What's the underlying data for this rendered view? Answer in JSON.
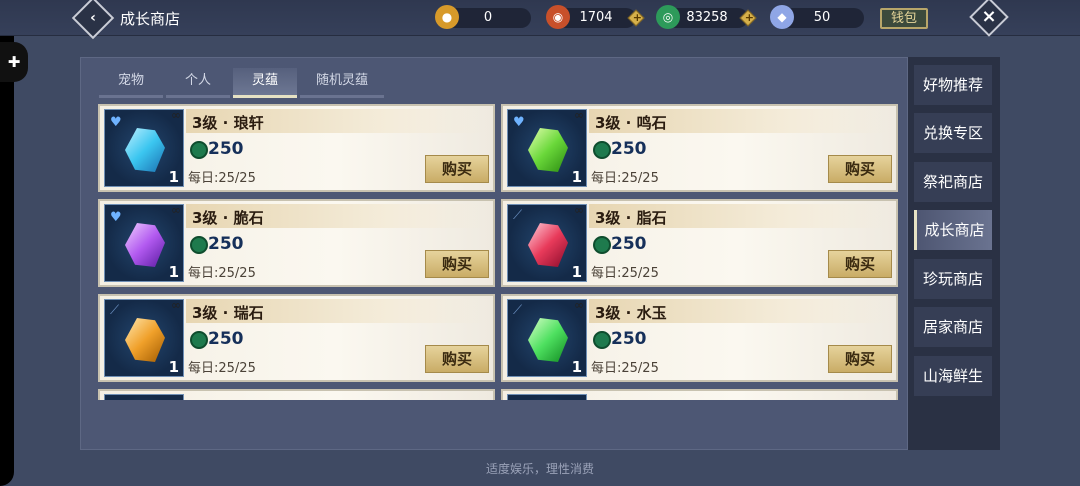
{
  "header": {
    "title": "成长商店",
    "wallet_label": "钱包",
    "currencies": [
      {
        "name": "coin-icon",
        "value": "0",
        "color": "#d79a2a"
      },
      {
        "name": "medal-icon",
        "value": "1704",
        "color": "#c8502a"
      },
      {
        "name": "jade-coin-icon",
        "value": "83258",
        "color": "#2d9a5a"
      },
      {
        "name": "crystal-icon",
        "value": "50",
        "color": "#8fa6e6"
      }
    ]
  },
  "tabs": [
    "宠物",
    "个人",
    "灵蕴",
    "随机灵蕴"
  ],
  "active_tab": "灵蕴",
  "items": [
    {
      "name": "3级 · 琅轩",
      "price": "250",
      "daily": "每日:25/25",
      "qty": "1",
      "buy": "购买",
      "gem_color": "#3bc6f0",
      "badge": "heart"
    },
    {
      "name": "3级 · 鸣石",
      "price": "250",
      "daily": "每日:25/25",
      "qty": "1",
      "buy": "购买",
      "gem_color": "#6ad83a",
      "badge": "heart"
    },
    {
      "name": "3级 · 脆石",
      "price": "250",
      "daily": "每日:25/25",
      "qty": "1",
      "buy": "购买",
      "gem_color": "#b25af0",
      "badge": "heart"
    },
    {
      "name": "3级 · 脂石",
      "price": "250",
      "daily": "每日:25/25",
      "qty": "1",
      "buy": "购买",
      "gem_color": "#e83a5a",
      "badge": "sword"
    },
    {
      "name": "3级 · 瑞石",
      "price": "250",
      "daily": "每日:25/25",
      "qty": "1",
      "buy": "购买",
      "gem_color": "#f0a02a",
      "badge": "sword"
    },
    {
      "name": "3级 · 水玉",
      "price": "250",
      "daily": "每日:25/25",
      "qty": "1",
      "buy": "购买",
      "gem_color": "#4ee060",
      "badge": "sword"
    }
  ],
  "nav": [
    "好物推荐",
    "兑换专区",
    "祭祀商店",
    "成长商店",
    "珍玩商店",
    "居家商店",
    "山海鲜生"
  ],
  "active_nav": "成长商店",
  "footer": "适度娱乐，理性消费"
}
